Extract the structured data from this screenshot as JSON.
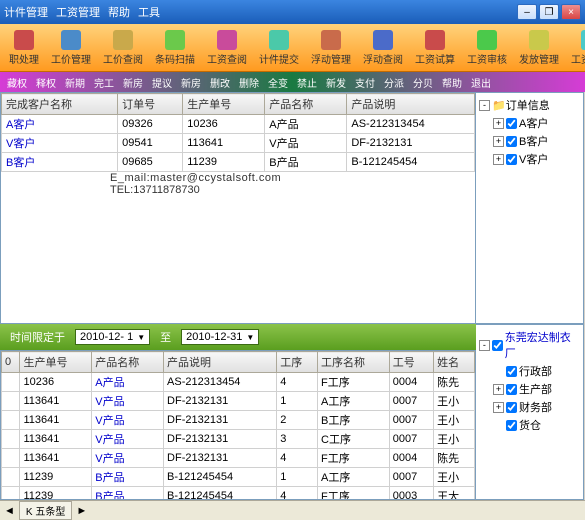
{
  "titlebar": {
    "menus": [
      "计件管理",
      "工资管理",
      "帮助",
      "工具"
    ]
  },
  "toolbar1": [
    {
      "label": "职处理",
      "color": "#c94b4b"
    },
    {
      "label": "工价管理",
      "color": "#4b8bc9"
    },
    {
      "label": "工价查阅",
      "color": "#c9a94b"
    },
    {
      "label": "条码扫描",
      "color": "#6bc94b"
    },
    {
      "label": "工资查阅",
      "color": "#c94b9b"
    },
    {
      "label": "计件提交",
      "color": "#4bc9a9"
    },
    {
      "label": "浮动管理",
      "color": "#c96b4b"
    },
    {
      "label": "浮动查阅",
      "color": "#4b6bc9"
    },
    {
      "label": "工资试算",
      "color": "#c94b4b"
    },
    {
      "label": "工资审核",
      "color": "#4bc94b"
    },
    {
      "label": "发放管理",
      "color": "#c9c94b"
    },
    {
      "label": "工资查询",
      "color": "#4bc9c9"
    }
  ],
  "toolbar2": [
    "藏权",
    "释权",
    "新期",
    "完工",
    "新房",
    "提议",
    "新房",
    "删改",
    "删除",
    "全变",
    "禁止",
    "新发",
    "支付",
    "分派",
    "分贝",
    "帮助",
    "退出"
  ],
  "upperGrid": {
    "headers": [
      "完成客户名称",
      "订单号",
      "生产单号",
      "产品名称",
      "产品说明"
    ],
    "rows": [
      [
        "A客户",
        "09326",
        "10236",
        "A产品",
        "AS-212313454"
      ],
      [
        "V客户",
        "09541",
        "113641",
        "V产品",
        "DF-2132131"
      ],
      [
        "B客户",
        "09685",
        "11239",
        "B产品",
        "B-121245454"
      ]
    ]
  },
  "upperTree": {
    "root": "订单信息",
    "children": [
      "A客户",
      "B客户",
      "V客户"
    ]
  },
  "watermark": {
    "email": "E_mail:master@ccystalsoft.com",
    "tel": "TEL:13711878730"
  },
  "dateBar": {
    "label": "时间限定于",
    "from": "2010-12- 1",
    "toLabel": "至",
    "to": "2010-12-31"
  },
  "lowerGrid": {
    "headers": [
      "0",
      "生产单号",
      "产品名称",
      "产品说明",
      "工序",
      "工序名称",
      "工号",
      "姓名"
    ],
    "rows": [
      [
        "",
        "10236",
        "A产品",
        "AS-212313454",
        "4",
        "F工序",
        "0004",
        "陈先"
      ],
      [
        "",
        "113641",
        "V产品",
        "DF-2132131",
        "1",
        "A工序",
        "0007",
        "王小"
      ],
      [
        "",
        "113641",
        "V产品",
        "DF-2132131",
        "2",
        "B工序",
        "0007",
        "王小"
      ],
      [
        "",
        "113641",
        "V产品",
        "DF-2132131",
        "3",
        "C工序",
        "0007",
        "王小"
      ],
      [
        "",
        "113641",
        "V产品",
        "DF-2132131",
        "4",
        "F工序",
        "0004",
        "陈先"
      ],
      [
        "",
        "11239",
        "B产品",
        "B-121245454",
        "1",
        "A工序",
        "0007",
        "王小"
      ],
      [
        "",
        "11239",
        "B产品",
        "B-121245454",
        "4",
        "F工序",
        "0003",
        "王大"
      ]
    ]
  },
  "lowerTree": {
    "root": "东莞宏达制衣厂",
    "children": [
      "行政部",
      "生产部",
      "财务部",
      "货仓"
    ]
  },
  "statusbar": {
    "tab": "K 五条型"
  }
}
